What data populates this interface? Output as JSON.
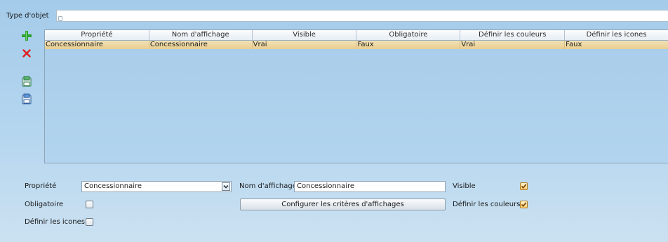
{
  "type_field": {
    "label": "Type d'objet",
    "value": ""
  },
  "toolbar": {
    "icons": [
      "add-icon",
      "delete-icon",
      "save-icon",
      "load-icon"
    ]
  },
  "grid": {
    "columns": [
      "Propriété",
      "Nom d'affichage",
      "Visible",
      "Obligatoire",
      "Définir les couleurs",
      "Définir les icones"
    ],
    "rows": [
      [
        "Concessionnaire",
        "Concessionnaire",
        "Vrai",
        "Faux",
        "Vrai",
        "Faux"
      ]
    ],
    "selected_row_color": "#edd79f"
  },
  "form": {
    "propriete_label": "Propriété",
    "propriete_value": "Concessionnaire",
    "nom_affichage_label": "Nom d'affichage",
    "nom_affichage_value": "Concessionnaire",
    "visible_label": "Visible",
    "visible_checked": true,
    "obligatoire_label": "Obligatoire",
    "obligatoire_checked": false,
    "configure_button": "Configurer les critères d'affichages",
    "couleurs_label": "Définir les couleurs",
    "couleurs_checked": true,
    "icones_label": "Définir les icones",
    "icones_checked": false
  },
  "colors": {
    "background": "#b5d6ef",
    "add_icon": "#2ea12e",
    "delete_icon": "#e02020",
    "checkbox_checked": "#ffcf72"
  }
}
